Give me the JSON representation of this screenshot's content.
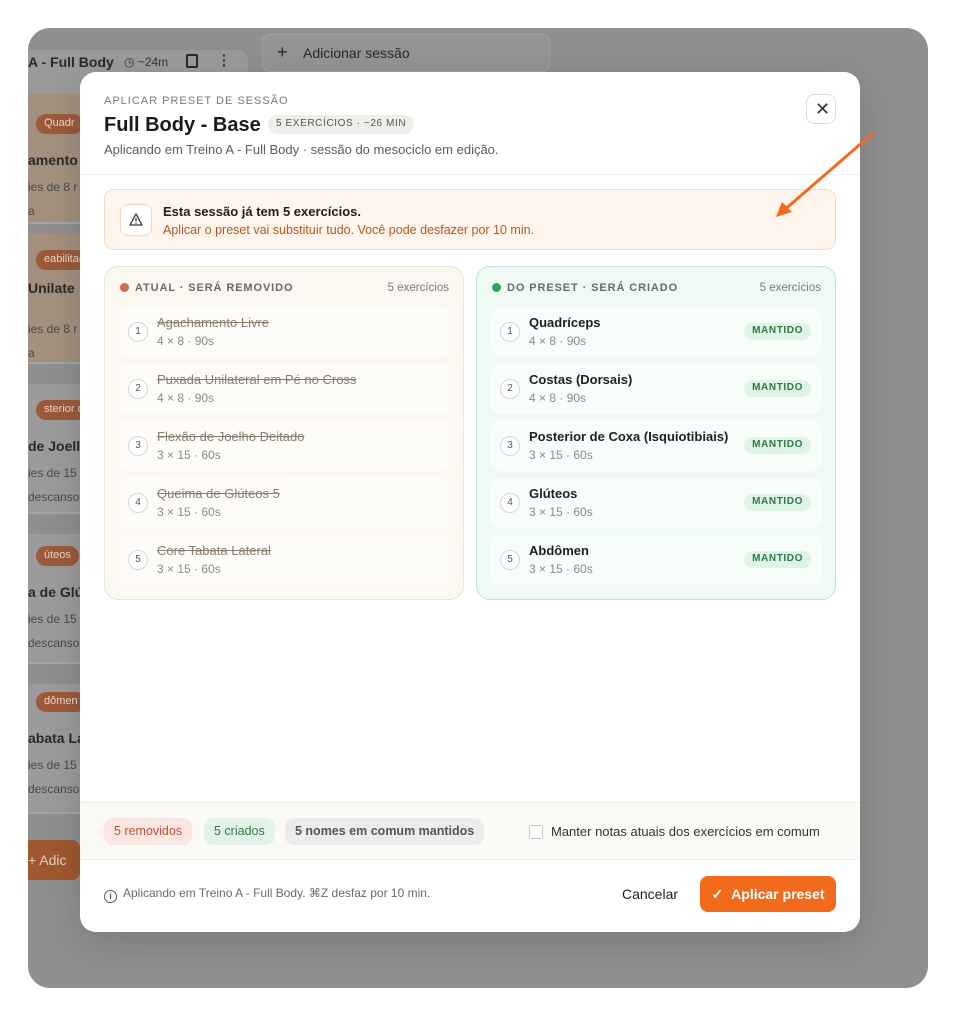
{
  "background": {
    "session_title": "A - Full Body",
    "session_duration": "~24m",
    "add_session_label": "Adicionar sessão",
    "cards": [
      {
        "chip": "Quadr",
        "line": "amento L",
        "sub1": "ies de 8 r",
        "sub2": "a"
      },
      {
        "chip": "eabilitaç",
        "line": "Unilate",
        "sub1": "ies de 8 r",
        "sub2": "a"
      },
      {
        "chip": "sterior de",
        "line": "de Joell",
        "sub1": "ies de 15",
        "sub2": "descanso"
      },
      {
        "chip": "úteos",
        "line": "a de Glút",
        "sub1": "ies de 15",
        "sub2": "descanso"
      },
      {
        "chip": "dômen",
        "line": "abata La",
        "sub1": "ies de 15",
        "sub2": "descanso"
      }
    ],
    "add_exercise_label": "+ Adic"
  },
  "modal": {
    "kicker": "APLICAR PRESET DE SESSÃO",
    "title": "Full Body - Base",
    "badge": "5 EXERCÍCIOS · ~26 MIN",
    "subtitle": "Aplicando em Treino A - Full Body · sessão do mesociclo em edição.",
    "close_icon": "close-icon"
  },
  "alert": {
    "title": "Esta sessão já tem 5 exercícios.",
    "text": "Aplicar o preset vai substituir tudo. Você pode desfazer por 10 min."
  },
  "current": {
    "header": "ATUAL · SERÁ REMOVIDO",
    "count": "5 exercícios",
    "dot_color": "#d1694a",
    "items": [
      {
        "num": "1",
        "name": "Agachamento Livre",
        "spec": "4 × 8 · 90s"
      },
      {
        "num": "2",
        "name": "Puxada Unilateral em Pé no Cross",
        "spec": "4 × 8 · 90s"
      },
      {
        "num": "3",
        "name": "Flexão de Joelho Deitado",
        "spec": "3 × 15 · 60s"
      },
      {
        "num": "4",
        "name": "Queima de Glúteos 5",
        "spec": "3 × 15 · 60s"
      },
      {
        "num": "5",
        "name": "Core Tabata Lateral",
        "spec": "3 × 15 · 60s"
      }
    ]
  },
  "preset": {
    "header": "DO PRESET · SERÁ CRIADO",
    "count": "5 exercícios",
    "dot_color": "#2fa35b",
    "items": [
      {
        "num": "1",
        "name": "Quadríceps",
        "spec": "4 × 8 · 90s",
        "tag": "MANTIDO"
      },
      {
        "num": "2",
        "name": "Costas (Dorsais)",
        "spec": "4 × 8 · 90s",
        "tag": "MANTIDO"
      },
      {
        "num": "3",
        "name": "Posterior de Coxa (Isquiotibiais)",
        "spec": "3 × 15 · 60s",
        "tag": "MANTIDO"
      },
      {
        "num": "4",
        "name": "Glúteos",
        "spec": "3 × 15 · 60s",
        "tag": "MANTIDO"
      },
      {
        "num": "5",
        "name": "Abdômen",
        "spec": "3 × 15 · 60s",
        "tag": "MANTIDO"
      }
    ]
  },
  "summary": {
    "removed": "5 removidos",
    "created": "5 criados",
    "kept": "5 nomes em comum mantidos",
    "checkbox_label": "Manter notas atuais dos exercícios em comum",
    "checkbox_checked": false
  },
  "footer": {
    "info": "Aplicando em Treino A - Full Body. ⌘Z desfaz por 10 min.",
    "cancel": "Cancelar",
    "apply": "Aplicar preset"
  },
  "colors": {
    "accent": "#f26b1d",
    "annotation_arrow": "#f26b1d"
  }
}
